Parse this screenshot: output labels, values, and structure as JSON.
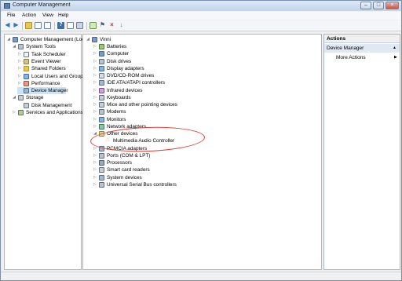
{
  "window": {
    "title": "Computer Management"
  },
  "menu": [
    "File",
    "Action",
    "View",
    "Help"
  ],
  "left_tree": [
    {
      "label": "Computer Management (Local",
      "level": 0,
      "icon": "computer-management-icon",
      "arrow": "expanded"
    },
    {
      "label": "System Tools",
      "level": 1,
      "icon": "tools-icon",
      "arrow": "expanded"
    },
    {
      "label": "Task Scheduler",
      "level": 2,
      "icon": "clock-icon",
      "arrow": "collapsed"
    },
    {
      "label": "Event Viewer",
      "level": 2,
      "icon": "event-viewer-icon",
      "arrow": "collapsed"
    },
    {
      "label": "Shared Folders",
      "level": 2,
      "icon": "shared-folder-icon",
      "arrow": "collapsed"
    },
    {
      "label": "Local Users and Groups",
      "level": 2,
      "icon": "users-icon",
      "arrow": "collapsed"
    },
    {
      "label": "Performance",
      "level": 2,
      "icon": "performance-icon",
      "arrow": "collapsed"
    },
    {
      "label": "Device Manager",
      "level": 2,
      "icon": "device-manager-icon",
      "arrow": "none",
      "selected": true
    },
    {
      "label": "Storage",
      "level": 1,
      "icon": "storage-icon",
      "arrow": "expanded"
    },
    {
      "label": "Disk Management",
      "level": 2,
      "icon": "disk-icon",
      "arrow": "none"
    },
    {
      "label": "Services and Applications",
      "level": 1,
      "icon": "services-icon",
      "arrow": "collapsed"
    }
  ],
  "device_tree": {
    "root": "Vinni",
    "items": [
      {
        "label": "Batteries",
        "icon": "battery-icon"
      },
      {
        "label": "Computer",
        "icon": "computer-icon"
      },
      {
        "label": "Disk drives",
        "icon": "disk-drive-icon"
      },
      {
        "label": "Display adapters",
        "icon": "display-icon"
      },
      {
        "label": "DVD/CD-ROM drives",
        "icon": "dvd-icon"
      },
      {
        "label": "IDE ATA/ATAPI controllers",
        "icon": "ide-icon"
      },
      {
        "label": "Infrared devices",
        "icon": "infrared-icon"
      },
      {
        "label": "Keyboards",
        "icon": "keyboard-icon"
      },
      {
        "label": "Mice and other pointing devices",
        "icon": "mouse-icon"
      },
      {
        "label": "Modems",
        "icon": "modem-icon"
      },
      {
        "label": "Monitors",
        "icon": "monitor-icon"
      },
      {
        "label": "Network adapters",
        "icon": "network-icon"
      },
      {
        "label": "Other devices",
        "icon": "other-devices-icon",
        "expanded": true
      },
      {
        "label": "Multimedia Audio Controller",
        "icon": "warning-device-icon",
        "child": true
      },
      {
        "label": "PCMCIA adapters",
        "icon": "pcmcia-icon"
      },
      {
        "label": "Ports (COM & LPT)",
        "icon": "port-icon"
      },
      {
        "label": "Processors",
        "icon": "processor-icon"
      },
      {
        "label": "Smart card readers",
        "icon": "smartcard-icon"
      },
      {
        "label": "System devices",
        "icon": "system-device-icon"
      },
      {
        "label": "Universal Serial Bus controllers",
        "icon": "usb-icon"
      }
    ]
  },
  "actions": {
    "header": "Actions",
    "section": "Device Manager",
    "more": "More Actions"
  },
  "colors": {
    "annotation": "#e03a2f",
    "selection": "#cce4f7",
    "accent": "#3a6ea5"
  }
}
